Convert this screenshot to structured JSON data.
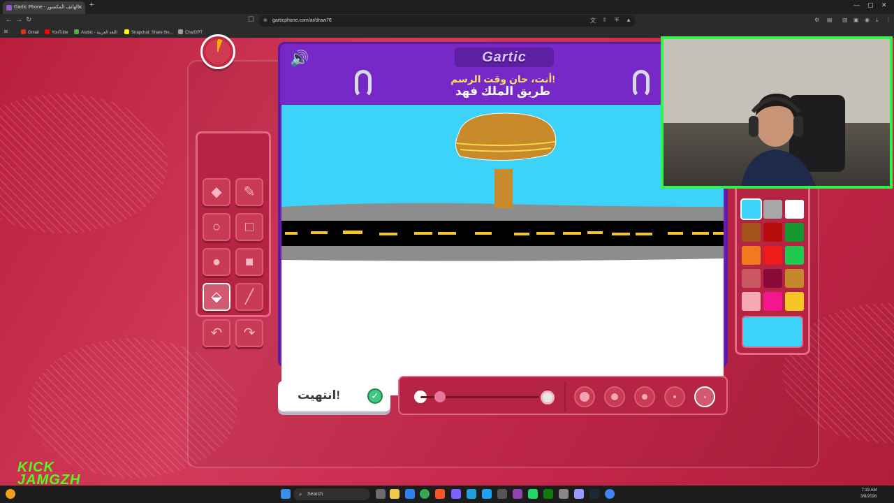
{
  "browser": {
    "tab_title": "Gartic Phone - الهاتف المكسور",
    "tab_close": "✕",
    "new_tab": "+",
    "url": "garticphone.com/ar/draw76",
    "bookmarks": [
      "Gmail",
      "YouTube",
      "Arabic - اللغة العربية",
      "Snapchat: Share the...",
      "ChatGPT"
    ],
    "bookmark_colors": [
      "#d93025",
      "#ff0000",
      "#4caf50",
      "#fffc00",
      "#9e9e9e"
    ]
  },
  "game": {
    "logo": "Gartic",
    "prompt_sub": "أنت، حان وقت الرسم!",
    "prompt_main": "طريق الملك فهد",
    "timer_progress": 0.06,
    "done_label": "انتهيت!",
    "done_check": "✓",
    "tools": [
      {
        "name": "eraser",
        "icon": "◆"
      },
      {
        "name": "pen",
        "icon": "✎"
      },
      {
        "name": "ellipse-outline",
        "icon": "○"
      },
      {
        "name": "rectangle-outline",
        "icon": "□"
      },
      {
        "name": "ellipse-filled",
        "icon": "●"
      },
      {
        "name": "rectangle-filled",
        "icon": "■"
      },
      {
        "name": "fill-bucket",
        "icon": "⬙"
      },
      {
        "name": "line",
        "icon": "╱"
      },
      {
        "name": "undo",
        "icon": "↶"
      },
      {
        "name": "redo",
        "icon": "↷"
      }
    ],
    "active_tool": "fill-bucket",
    "palette": [
      "#3dd2f7",
      "#a7a7a7",
      "#ffffff",
      "#a4521c",
      "#b50d0d",
      "#139a2e",
      "#f17a1f",
      "#ee1b1b",
      "#1ec94b",
      "#c95761",
      "#8c0a39",
      "#c7882b",
      "#f7a8b0",
      "#f3168e",
      "#f5c526"
    ],
    "selected_color": "#3dd2f7",
    "opacity_level": 0.82
  },
  "icons": {
    "sound": "🔊",
    "undo": "↶",
    "redo": "↷"
  },
  "overlay": {
    "streamer_brand": "KICK\nJAMGZH"
  },
  "taskbar": {
    "search_label": "Search",
    "time": "7:19 AM",
    "date": "3/8/2026"
  }
}
